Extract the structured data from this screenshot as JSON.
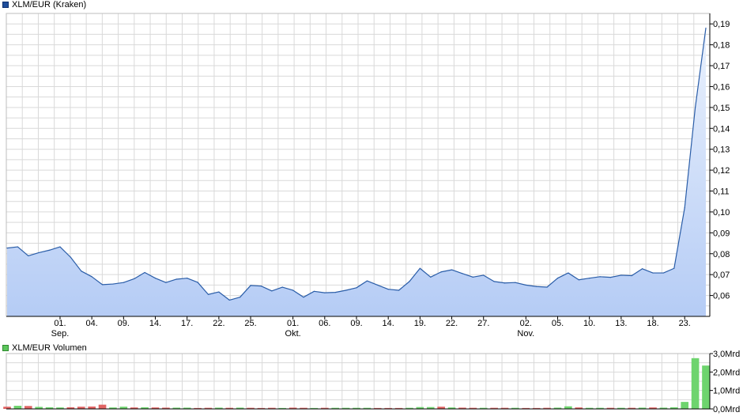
{
  "colors": {
    "price_line": "#2a5da8",
    "price_fill_top": "#eaf1fd",
    "price_fill_bottom": "#b5ccf5",
    "grid": "#d9d9d9",
    "vol_up": "#6ed46e",
    "vol_down": "#e06464",
    "legend_price": "#1f4e9b",
    "legend_volume": "#5cc65c"
  },
  "chart_data": [
    {
      "type": "area",
      "legend": "XLM/EUR (Kraken)",
      "ylim": [
        0.05,
        0.195
      ],
      "yticks": [
        {
          "v": 0.06,
          "label": "0,06"
        },
        {
          "v": 0.07,
          "label": "0,07"
        },
        {
          "v": 0.08,
          "label": "0,08"
        },
        {
          "v": 0.09,
          "label": "0,09"
        },
        {
          "v": 0.1,
          "label": "0,10"
        },
        {
          "v": 0.11,
          "label": "0,11"
        },
        {
          "v": 0.12,
          "label": "0,12"
        },
        {
          "v": 0.13,
          "label": "0,13"
        },
        {
          "v": 0.14,
          "label": "0,14"
        },
        {
          "v": 0.15,
          "label": "0,15"
        },
        {
          "v": 0.16,
          "label": "0,16"
        },
        {
          "v": 0.17,
          "label": "0,17"
        },
        {
          "v": 0.18,
          "label": "0,18"
        },
        {
          "v": 0.19,
          "label": "0,19"
        }
      ],
      "xticks": [
        {
          "i": 5,
          "label": "01.",
          "sub": "Sep."
        },
        {
          "i": 8,
          "label": "04."
        },
        {
          "i": 11,
          "label": "09."
        },
        {
          "i": 14,
          "label": "14."
        },
        {
          "i": 17,
          "label": "17."
        },
        {
          "i": 20,
          "label": "22."
        },
        {
          "i": 23,
          "label": "25."
        },
        {
          "i": 27,
          "label": "01.",
          "sub": "Okt."
        },
        {
          "i": 30,
          "label": "06."
        },
        {
          "i": 33,
          "label": "09."
        },
        {
          "i": 36,
          "label": "14."
        },
        {
          "i": 39,
          "label": "19."
        },
        {
          "i": 42,
          "label": "22."
        },
        {
          "i": 45,
          "label": "27."
        },
        {
          "i": 49,
          "label": "02.",
          "sub": "Nov."
        },
        {
          "i": 52,
          "label": "05."
        },
        {
          "i": 55,
          "label": "10."
        },
        {
          "i": 58,
          "label": "13."
        },
        {
          "i": 61,
          "label": "18."
        },
        {
          "i": 64,
          "label": "23."
        }
      ],
      "values": [
        0.0827,
        0.0833,
        0.079,
        0.0805,
        0.0817,
        0.0833,
        0.0783,
        0.0717,
        0.069,
        0.0652,
        0.0655,
        0.0662,
        0.068,
        0.071,
        0.0683,
        0.0662,
        0.0678,
        0.0683,
        0.0663,
        0.0605,
        0.0617,
        0.0578,
        0.0592,
        0.0648,
        0.0645,
        0.0622,
        0.064,
        0.0625,
        0.0592,
        0.062,
        0.0613,
        0.0615,
        0.0625,
        0.0637,
        0.067,
        0.065,
        0.063,
        0.0625,
        0.0667,
        0.073,
        0.0688,
        0.0713,
        0.0723,
        0.0705,
        0.0688,
        0.0697,
        0.0667,
        0.066,
        0.0662,
        0.065,
        0.0643,
        0.064,
        0.0683,
        0.0708,
        0.0675,
        0.0683,
        0.069,
        0.0687,
        0.0697,
        0.0695,
        0.0728,
        0.0708,
        0.0708,
        0.073,
        0.102,
        0.15,
        0.188
      ]
    },
    {
      "type": "bar",
      "legend": "XLM/EUR Volumen",
      "ylim": [
        0,
        3.0
      ],
      "yticks": [
        {
          "v": 0,
          "label": "0,0Mrd"
        },
        {
          "v": 1,
          "label": "1,0Mrd"
        },
        {
          "v": 2,
          "label": "2,0Mrd"
        },
        {
          "v": 3,
          "label": "3,0Mrd"
        }
      ],
      "values": [
        0.12,
        0.17,
        0.16,
        0.11,
        0.09,
        0.08,
        0.09,
        0.12,
        0.13,
        0.23,
        0.08,
        0.12,
        0.08,
        0.09,
        0.08,
        0.07,
        0.07,
        0.07,
        0.05,
        0.06,
        0.07,
        0.06,
        0.07,
        0.06,
        0.05,
        0.06,
        0.05,
        0.07,
        0.06,
        0.05,
        0.06,
        0.06,
        0.06,
        0.06,
        0.06,
        0.05,
        0.05,
        0.05,
        0.06,
        0.1,
        0.1,
        0.12,
        0.08,
        0.07,
        0.06,
        0.06,
        0.06,
        0.06,
        0.06,
        0.05,
        0.05,
        0.06,
        0.07,
        0.14,
        0.08,
        0.06,
        0.06,
        0.06,
        0.06,
        0.06,
        0.07,
        0.08,
        0.07,
        0.09,
        0.38,
        2.75,
        2.35
      ],
      "direction": [
        "down",
        "up",
        "down",
        "up",
        "up",
        "up",
        "down",
        "down",
        "down",
        "down",
        "up",
        "up",
        "down",
        "up",
        "down",
        "down",
        "up",
        "up",
        "down",
        "down",
        "up",
        "down",
        "up",
        "down",
        "down",
        "down",
        "up",
        "down",
        "down",
        "up",
        "down",
        "up",
        "up",
        "up",
        "up",
        "down",
        "down",
        "down",
        "up",
        "up",
        "up",
        "down",
        "up",
        "down",
        "down",
        "up",
        "down",
        "down",
        "up",
        "down",
        "down",
        "down",
        "up",
        "up",
        "down",
        "up",
        "up",
        "down",
        "up",
        "down",
        "up",
        "down",
        "up",
        "up",
        "up",
        "up",
        "up"
      ]
    }
  ]
}
